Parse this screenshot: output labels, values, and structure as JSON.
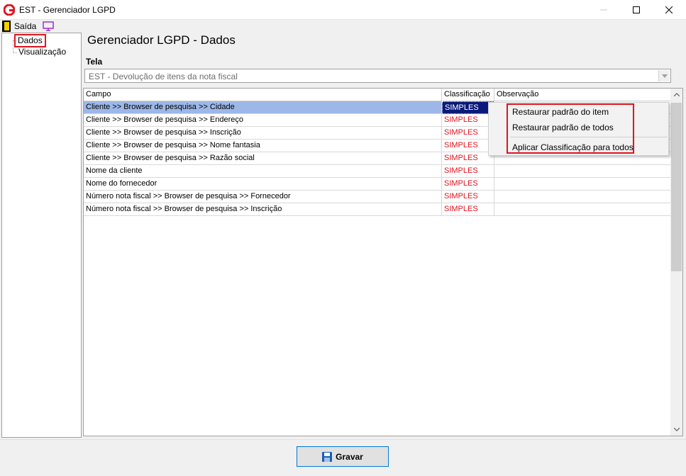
{
  "window": {
    "title": "EST - Gerenciador LGPD"
  },
  "menu": {
    "exit_label": "Saída"
  },
  "tree": {
    "items": [
      {
        "label": "Dados"
      },
      {
        "label": "Visualização"
      }
    ]
  },
  "main": {
    "title": "Gerenciador LGPD - Dados",
    "tela_label": "Tela",
    "tela_value": "EST - Devolução de itens da nota fiscal"
  },
  "grid": {
    "columns": [
      "Campo",
      "Classificação",
      "Observação"
    ],
    "rows": [
      {
        "campo": "Cliente >> Browser de pesquisa >> Cidade",
        "classificacao": "SIMPLES",
        "observacao": ""
      },
      {
        "campo": "Cliente >> Browser de pesquisa >> Endereço",
        "classificacao": "SIMPLES",
        "observacao": ""
      },
      {
        "campo": "Cliente >> Browser de pesquisa >> Inscrição",
        "classificacao": "SIMPLES",
        "observacao": ""
      },
      {
        "campo": "Cliente >> Browser de pesquisa >> Nome fantasia",
        "classificacao": "SIMPLES",
        "observacao": ""
      },
      {
        "campo": "Cliente >> Browser de pesquisa >> Razão social",
        "classificacao": "SIMPLES",
        "observacao": ""
      },
      {
        "campo": "Nome da cliente",
        "classificacao": "SIMPLES",
        "observacao": ""
      },
      {
        "campo": "Nome do fornecedor",
        "classificacao": "SIMPLES",
        "observacao": ""
      },
      {
        "campo": "Número nota fiscal >> Browser de pesquisa >> Fornecedor",
        "classificacao": "SIMPLES",
        "observacao": ""
      },
      {
        "campo": "Número nota fiscal >> Browser de pesquisa >> Inscrição",
        "classificacao": "SIMPLES",
        "observacao": ""
      }
    ]
  },
  "context_menu": {
    "items": [
      "Restaurar padrão do item",
      "Restaurar padrão de todos",
      "Aplicar Classificação para todos"
    ]
  },
  "footer": {
    "save_label": "Gravar"
  },
  "colors": {
    "accent_red": "#e0141e",
    "selection_blue": "#9db7e8",
    "button_border": "#0078d7"
  }
}
